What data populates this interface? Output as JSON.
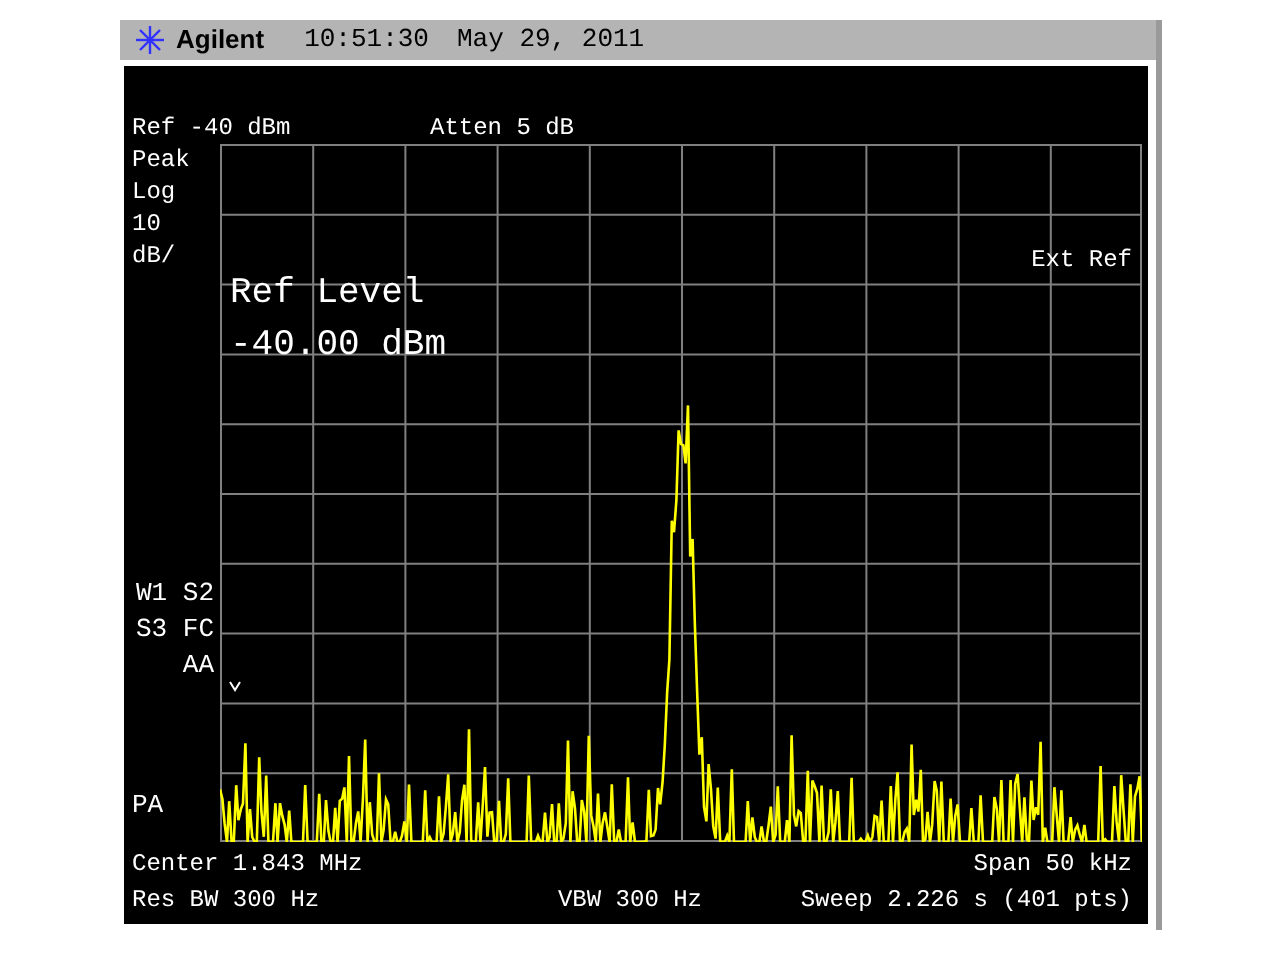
{
  "header": {
    "brand": "Agilent",
    "time": "10:51:30",
    "date": "May 29, 2011"
  },
  "display": {
    "ref": "Ref -40 dBm",
    "atten": "Atten 5 dB",
    "scale_labels": [
      "Peak",
      "Log",
      "10",
      "dB/"
    ],
    "status_labels": [
      "W1 S2",
      "S3 FC",
      "AA"
    ],
    "pa": "PA",
    "ref_level_title": "Ref Level",
    "ref_level_value": "-40.00 dBm",
    "ext_ref": "Ext Ref",
    "center": "Center 1.843 MHz",
    "span": "Span 50 kHz",
    "res_bw": "Res BW 300 Hz",
    "vbw": "VBW 300 Hz",
    "sweep": "Sweep 2.226 s (401 pts)"
  }
}
